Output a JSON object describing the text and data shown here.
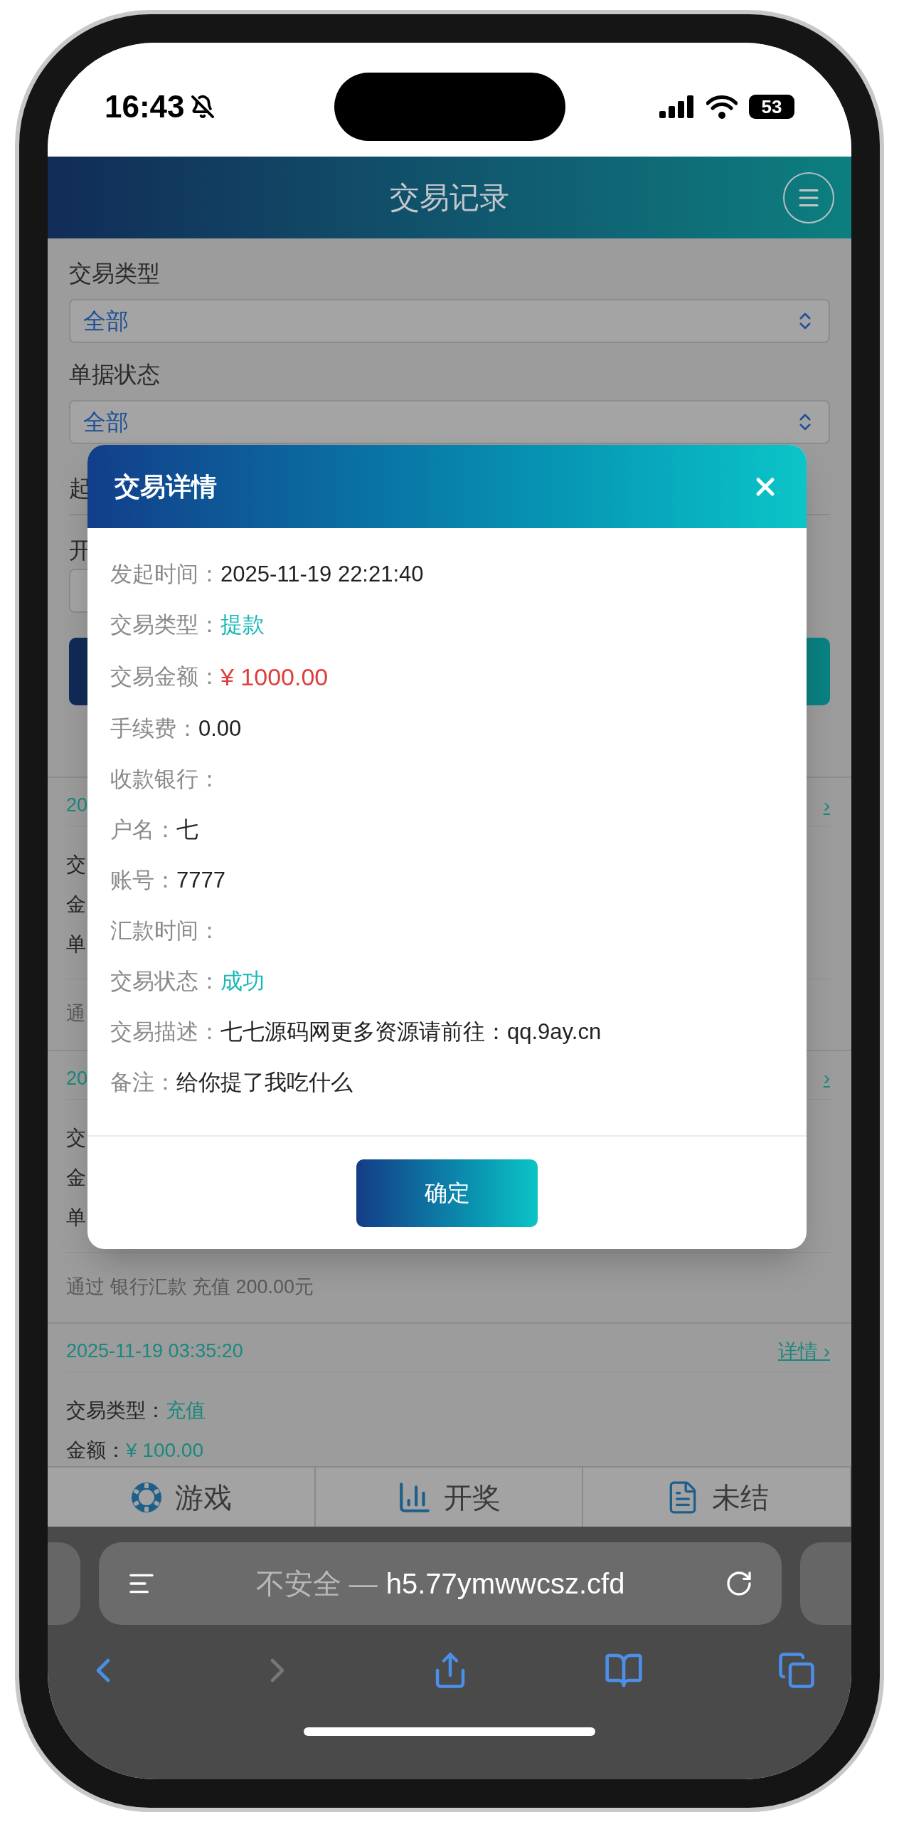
{
  "status_bar": {
    "time": "16:43",
    "battery": "53"
  },
  "header": {
    "title": "交易记录"
  },
  "filters": [
    {
      "label": "交易类型",
      "value": "全部"
    },
    {
      "label": "单据状态",
      "value": "全部"
    }
  ],
  "covered_labels": [
    "起",
    "开"
  ],
  "records": [
    {
      "date": "20",
      "detail": "›",
      "fields": [
        {
          "label": "交"
        },
        {
          "label": "金"
        },
        {
          "label": "单"
        }
      ],
      "note": "通"
    },
    {
      "date": "20",
      "detail": "›",
      "fields": [
        {
          "label": "交"
        },
        {
          "label": "金"
        },
        {
          "label": "单"
        }
      ],
      "note": "通过 银行汇款 充值 200.00元"
    },
    {
      "date": "2025-11-19 03:35:20",
      "detail": "详情 ›",
      "fields": [
        {
          "label": "交易类型：",
          "value": "充值"
        },
        {
          "label": "金额：",
          "value": "¥ 100.00"
        }
      ]
    }
  ],
  "tabs": [
    {
      "label": "游戏"
    },
    {
      "label": "开奖"
    },
    {
      "label": "未结"
    }
  ],
  "browser": {
    "security": "不安全 —",
    "url": "h5.77ymwwcsz.cfd"
  },
  "modal": {
    "title": "交易详情",
    "rows": [
      {
        "label": "发起时间：",
        "value": "2025-11-19 22:21:40",
        "kind": "plain"
      },
      {
        "label": "交易类型：",
        "value": "提款",
        "kind": "accent"
      },
      {
        "label": "交易金额：",
        "value": "¥ 1000.00",
        "kind": "amount"
      },
      {
        "label": "手续费：",
        "value": "0.00",
        "kind": "plain"
      },
      {
        "label": "收款银行：",
        "kind": "plain"
      },
      {
        "label": "户名：",
        "value": "七",
        "kind": "plain"
      },
      {
        "label": "账号：",
        "value": "7777",
        "kind": "plain"
      },
      {
        "label": "汇款时间：",
        "kind": "plain"
      },
      {
        "label": "交易状态：",
        "value": "成功",
        "kind": "accent"
      },
      {
        "label": "交易描述：",
        "value": "七七源码网更多资源请前往：qq.9ay.cn",
        "kind": "plain"
      },
      {
        "label": "备注：",
        "value": "给你提了我吃什么",
        "kind": "plain"
      }
    ],
    "button": "确定"
  }
}
